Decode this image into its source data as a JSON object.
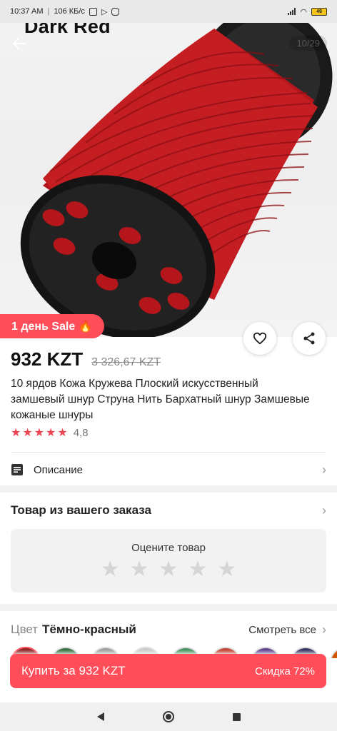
{
  "status_bar": {
    "time": "10:37 AM",
    "network_speed": "106 КБ/с",
    "battery": "49"
  },
  "hero": {
    "variant_title": "Dark Red",
    "counter": "10/29",
    "sale_badge": "1 день Sale 🔥"
  },
  "product": {
    "price": "932 KZT",
    "old_price": "3 326,67 KZT",
    "title": "10 ярдов Кожа Кружева Плоский искусственный замшевый шнур Струна Нить Бархатный шнур Замшевые кожаные шнуры",
    "rating": "4,8",
    "rating_stars": 5
  },
  "description": {
    "label": "Описание"
  },
  "order_section": {
    "title": "Товар из вашего заказа",
    "rate_label": "Оцените товар",
    "rate_stars_count": 5
  },
  "color": {
    "label": "Цвет",
    "value": "Тёмно-красный",
    "see_all": "Смотреть все"
  },
  "swatch_colors": [
    "#8b1a1a",
    "#2e6b3a",
    "#9a9a9a",
    "#c8c8c8",
    "#3e8e5a",
    "#c0392b",
    "#5b3a8a",
    "#2a2a5a",
    "#d35400"
  ],
  "buy_bar": {
    "label": "Купить за 932 KZT",
    "discount": "Скидка 72%"
  },
  "colors": {
    "accent": "#ff4d5a",
    "star": "#ef4452"
  }
}
